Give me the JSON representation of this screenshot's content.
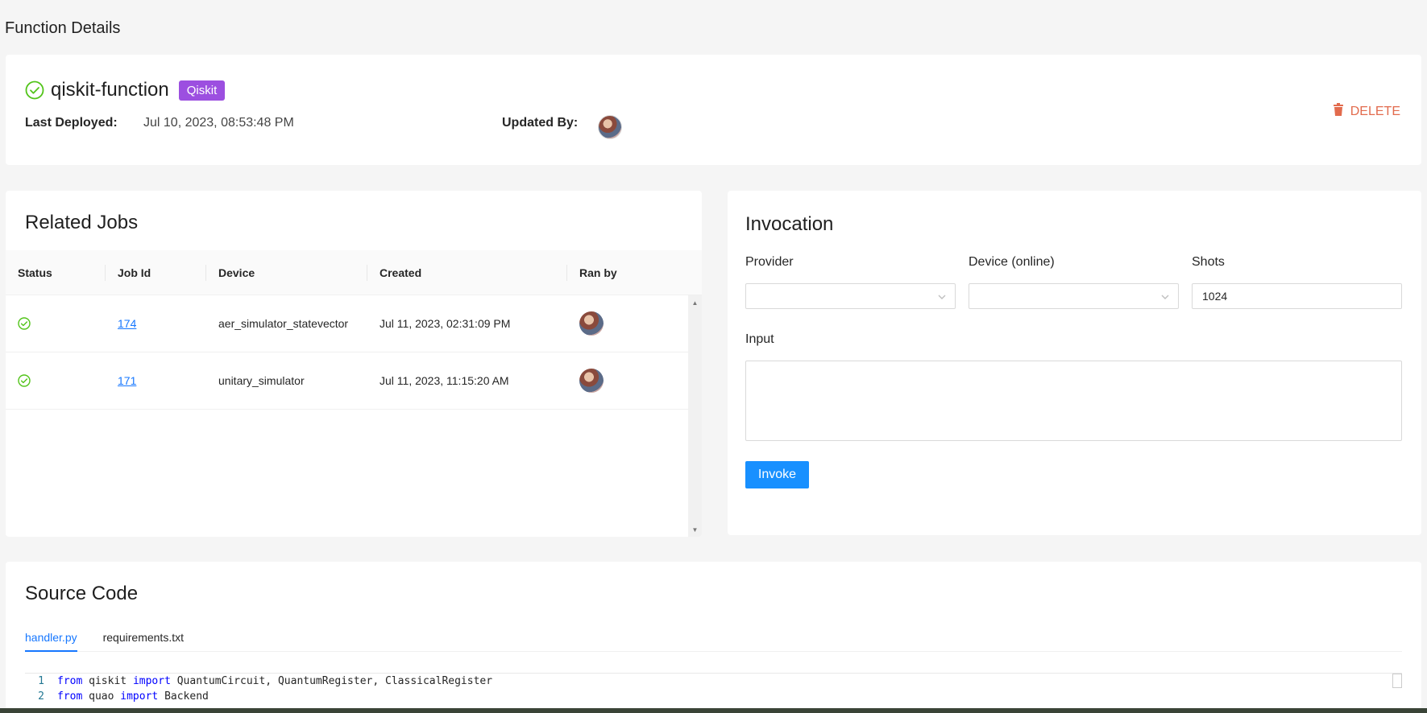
{
  "page": {
    "title": "Function Details"
  },
  "function": {
    "name": "qiskit-function",
    "tag": "Qiskit",
    "last_deployed_label": "Last Deployed:",
    "last_deployed_value": "Jul 10, 2023, 08:53:48 PM",
    "updated_by_label": "Updated By:",
    "delete_label": "DELETE",
    "accent_color": "#9c4fe0",
    "delete_color": "#e26b4d"
  },
  "jobs": {
    "title": "Related Jobs",
    "columns": [
      "Status",
      "Job Id",
      "Device",
      "Created",
      "Ran by"
    ],
    "rows": [
      {
        "status": "success",
        "job_id": "174",
        "device": "aer_simulator_statevector",
        "created": "Jul 11, 2023, 02:31:09 PM"
      },
      {
        "status": "success",
        "job_id": "171",
        "device": "unitary_simulator",
        "created": "Jul 11, 2023, 11:15:20 AM"
      }
    ]
  },
  "invocation": {
    "title": "Invocation",
    "provider_label": "Provider",
    "provider_value": "",
    "device_label": "Device (online)",
    "device_value": "",
    "shots_label": "Shots",
    "shots_value": "1024",
    "input_label": "Input",
    "input_value": "",
    "invoke_label": "Invoke",
    "button_color": "#1890ff"
  },
  "source": {
    "title": "Source Code",
    "tabs": [
      "handler.py",
      "requirements.txt"
    ],
    "active_tab": "handler.py",
    "lines": [
      {
        "n": "1",
        "kw1": "from",
        "mod": " qiskit ",
        "kw2": "import",
        "rest": " QuantumCircuit, QuantumRegister, ClassicalRegister"
      },
      {
        "n": "2",
        "kw1": "from",
        "mod": " quao ",
        "kw2": "import",
        "rest": " Backend"
      }
    ]
  }
}
